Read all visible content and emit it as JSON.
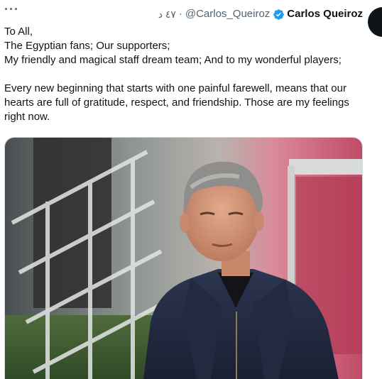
{
  "tweet": {
    "more_label": "···",
    "display_name": "Carlos Queiroz",
    "handle": "@Carlos_Queiroz",
    "separator": "·",
    "time": "٤٧ د",
    "lines": [
      "To All,",
      "The Egyptian fans; Our supporters;",
      "My friendly and magical staff dream team; And to my wonderful players;",
      "",
      "Every new beginning that starts with one painful farewell, means that our hearts are full of gratitude, respect, and friendship. Those are my feelings right now."
    ]
  },
  "icons": {
    "verified": "verified-badge-icon",
    "more": "more-dots-icon"
  },
  "colors": {
    "verified_blue": "#1d9bf0",
    "secondary_text": "#536471",
    "primary_text": "#0f1419"
  }
}
